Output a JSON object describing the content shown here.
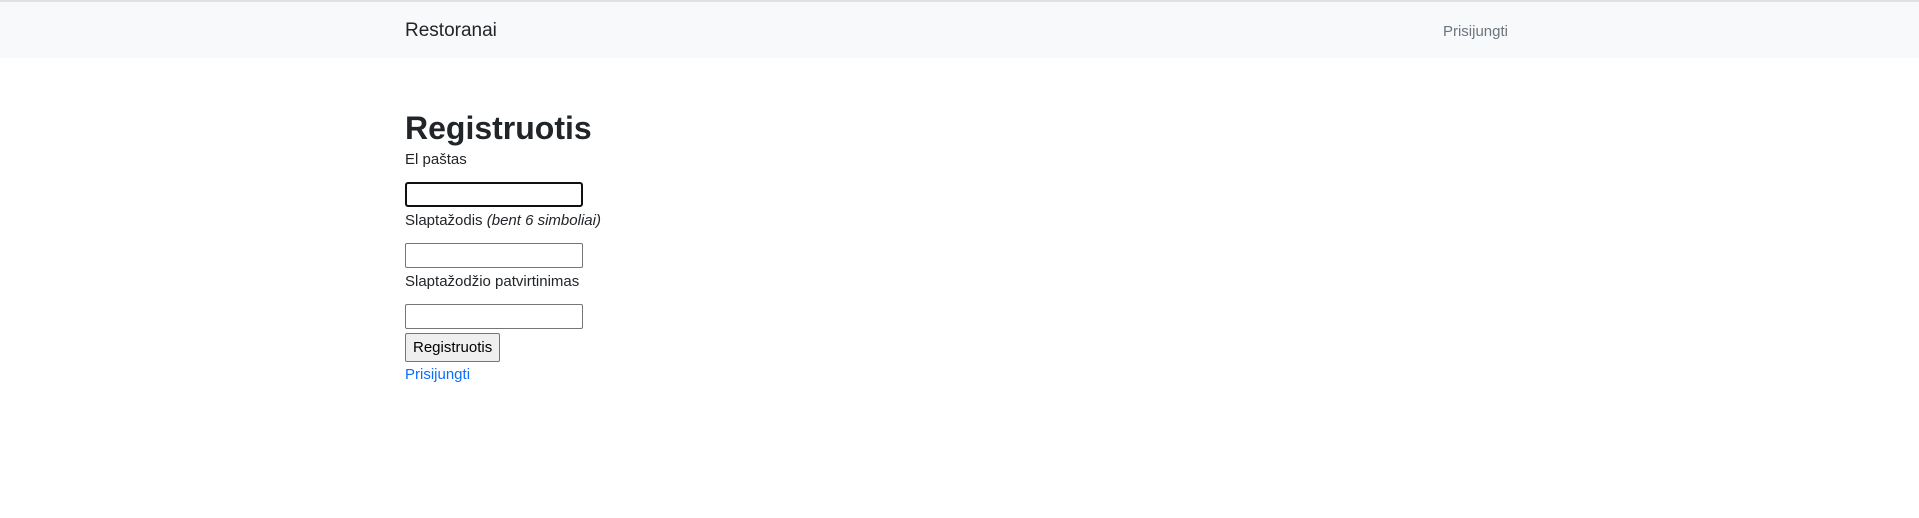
{
  "navbar": {
    "brand": "Restoranai",
    "login_link": "Prisijungti"
  },
  "form": {
    "title": "Registruotis",
    "email_label": "El paštas",
    "email_value": "",
    "password_label": "Slaptažodis",
    "password_hint": "(bent 6 simboliai)",
    "password_value": "",
    "confirm_label": "Slaptažodžio patvirtinimas",
    "confirm_value": "",
    "submit_label": "Registruotis",
    "login_link": "Prisijungti"
  },
  "colors": {
    "navbar_bg": "#f8f9fa",
    "link": "#0d6efd",
    "muted": "#6c757d"
  }
}
